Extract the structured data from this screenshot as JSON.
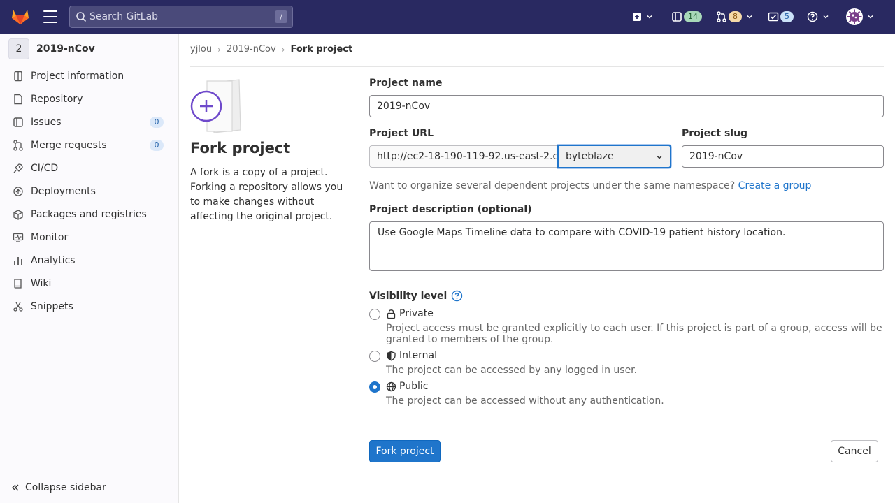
{
  "navbar": {
    "search_placeholder": "Search GitLab",
    "search_shortcut": "/",
    "merge_requests_count": "14",
    "issues_count": "8",
    "todos_count": "5",
    "colors": {
      "bg": "#292961",
      "mr_badge": "#a8d8b9",
      "issue_badge": "#f5d9a8",
      "todo_badge": "#cbe2f9"
    }
  },
  "sidebar": {
    "project_avatar_letter": "2",
    "project_name": "2019-nCov",
    "items": [
      {
        "label": "Project information",
        "icon": "info-icon"
      },
      {
        "label": "Repository",
        "icon": "doc-icon"
      },
      {
        "label": "Issues",
        "icon": "issues-icon",
        "count": "0"
      },
      {
        "label": "Merge requests",
        "icon": "merge-request-icon",
        "count": "0"
      },
      {
        "label": "CI/CD",
        "icon": "rocket-icon"
      },
      {
        "label": "Deployments",
        "icon": "deployments-icon"
      },
      {
        "label": "Packages and registries",
        "icon": "package-icon"
      },
      {
        "label": "Monitor",
        "icon": "monitor-icon"
      },
      {
        "label": "Analytics",
        "icon": "chart-icon"
      },
      {
        "label": "Wiki",
        "icon": "book-icon"
      },
      {
        "label": "Snippets",
        "icon": "snippet-icon"
      }
    ],
    "collapse_label": "Collapse sidebar"
  },
  "breadcrumb": {
    "items": [
      "yjlou",
      "2019-nCov"
    ],
    "current": "Fork project"
  },
  "intro": {
    "title": "Fork project",
    "description": "A fork is a copy of a project. Forking a repository allows you to make changes without affecting the original project."
  },
  "form": {
    "project_name_label": "Project name",
    "project_name_value": "2019-nCov",
    "project_url_label": "Project URL",
    "project_url_value": "http://ec2-18-190-119-92.us-east-2.c...",
    "namespace_value": "byteblaze",
    "project_slug_label": "Project slug",
    "project_slug_value": "2019-nCov",
    "namespace_help": "Want to organize several dependent projects under the same namespace?",
    "create_group_link": "Create a group",
    "description_label": "Project description (optional)",
    "description_value": "Use Google Maps Timeline data to compare with COVID-19 patient history location.",
    "visibility_label": "Visibility level",
    "visibility_options": [
      {
        "label": "Private",
        "desc": "Project access must be granted explicitly to each user. If this project is part of a group, access will be granted to members of the group.",
        "checked": false
      },
      {
        "label": "Internal",
        "desc": "The project can be accessed by any logged in user.",
        "checked": false
      },
      {
        "label": "Public",
        "desc": "The project can be accessed without any authentication.",
        "checked": true
      }
    ],
    "submit_label": "Fork project",
    "cancel_label": "Cancel"
  }
}
